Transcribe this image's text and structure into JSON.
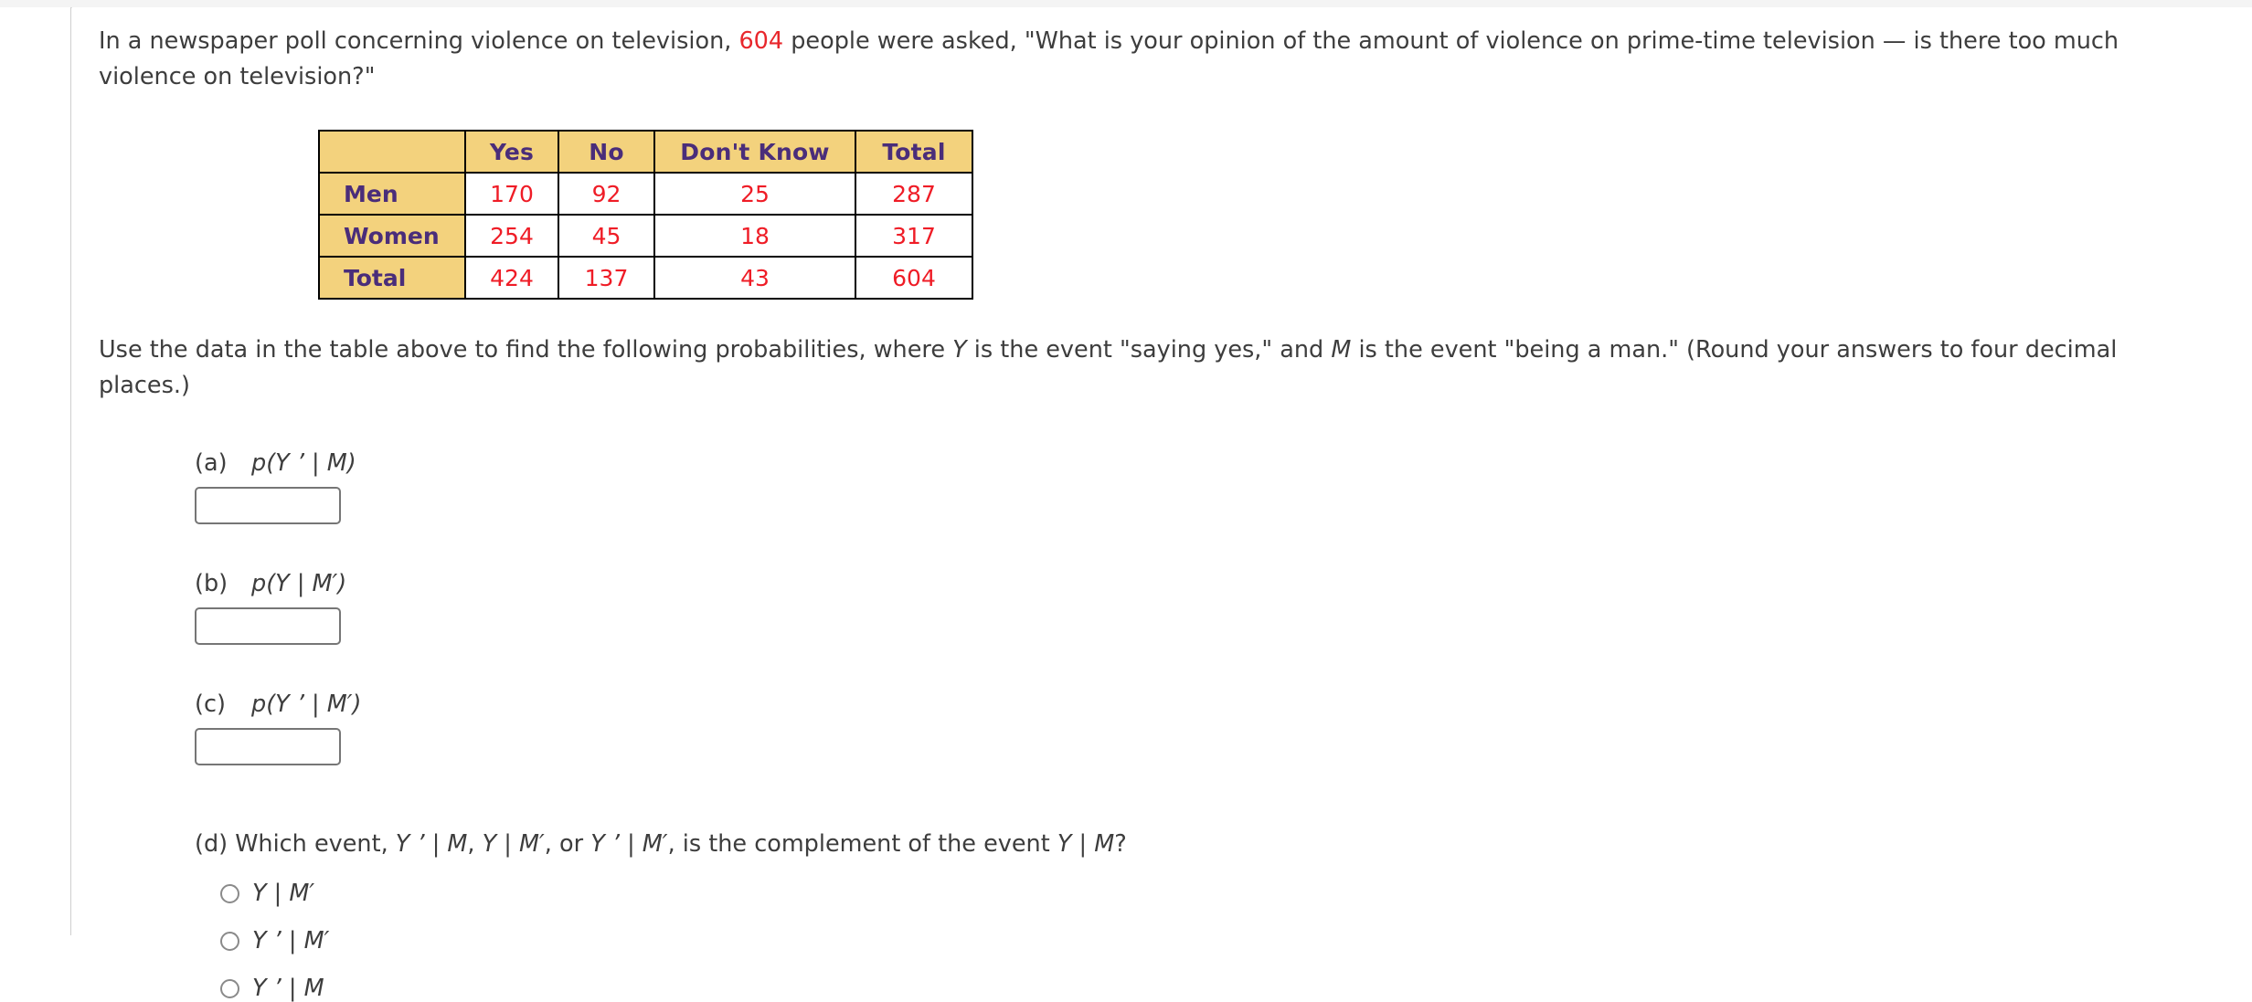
{
  "prompt": {
    "text_before_count": "In a newspaper poll concerning violence on television, ",
    "count": "604",
    "text_after_count": " people were asked, \"What is your opinion of the amount of violence on prime-time television — is there too much violence on television?\"",
    "highlight_color": "#e8272c"
  },
  "table": {
    "columns": [
      "",
      "Yes",
      "No",
      "Don't Know",
      "Total"
    ],
    "rows": [
      {
        "label": "Men",
        "cells": [
          "170",
          "92",
          "25",
          "287"
        ]
      },
      {
        "label": "Women",
        "cells": [
          "254",
          "45",
          "18",
          "317"
        ]
      },
      {
        "label": "Total",
        "cells": [
          "424",
          "137",
          "43",
          "604"
        ]
      }
    ],
    "header_bg": "#f3d27d",
    "header_color": "#4a2d7a",
    "number_color": "#ef1c26"
  },
  "instructions": {
    "p1": "Use the data in the table above to find the following probabilities, where ",
    "y": "Y",
    "p2": " is the event \"saying yes,\" and ",
    "m": "M",
    "p3": " is the event \"being a man.\" (Round your answers to four decimal places.)"
  },
  "questions": [
    {
      "letter": "(a)",
      "expr_p": "p",
      "expr_rest": "(Y ’ | M)",
      "value": "",
      "placeholder": ""
    },
    {
      "letter": "(b)",
      "expr_p": "p",
      "expr_rest": "(Y | M′)",
      "value": "",
      "placeholder": ""
    },
    {
      "letter": "(c)",
      "expr_p": "p",
      "expr_rest": "(Y ’ | M′)",
      "value": "",
      "placeholder": ""
    }
  ],
  "part_d": {
    "letter": "(d)",
    "prompt_a": "Which event, ",
    "e1": "Y ’ | M",
    "sep1": ", ",
    "e2": "Y | M′",
    "sep2": ", or ",
    "e3": "Y ’ | M′",
    "prompt_b": ", is the complement of the event ",
    "e4": "Y | M",
    "prompt_c": "?",
    "options": [
      {
        "label": "Y | M′",
        "selected": false
      },
      {
        "label": "Y ’ | M′",
        "selected": false
      },
      {
        "label": "Y ’ | M",
        "selected": false
      }
    ]
  }
}
